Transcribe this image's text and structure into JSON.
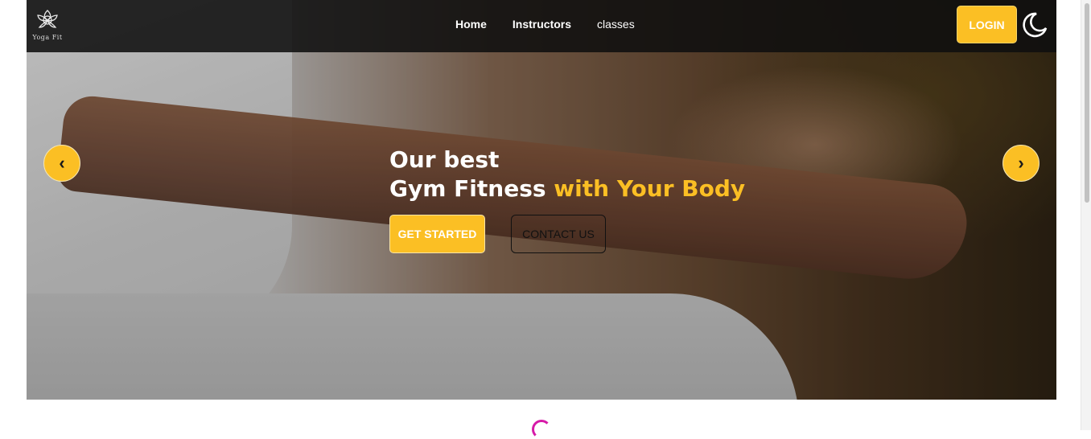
{
  "brand": {
    "logo_text": "Yoga Fit",
    "accent_color": "#fbbf24"
  },
  "nav": {
    "items": [
      "Home",
      "Instructors",
      "classes"
    ]
  },
  "header": {
    "login_label": "LOGIN",
    "theme_toggle_icon": "moon-icon"
  },
  "hero": {
    "line1": "Our best",
    "line2_main": "Gym Fitness ",
    "line2_accent": "with Your Body",
    "get_started_label": "GET STARTED",
    "contact_label": "CONTACT US",
    "prev_icon": "‹",
    "next_icon": "›"
  },
  "loader": {
    "icon": "spinner-icon",
    "color": "#d61aa8"
  }
}
